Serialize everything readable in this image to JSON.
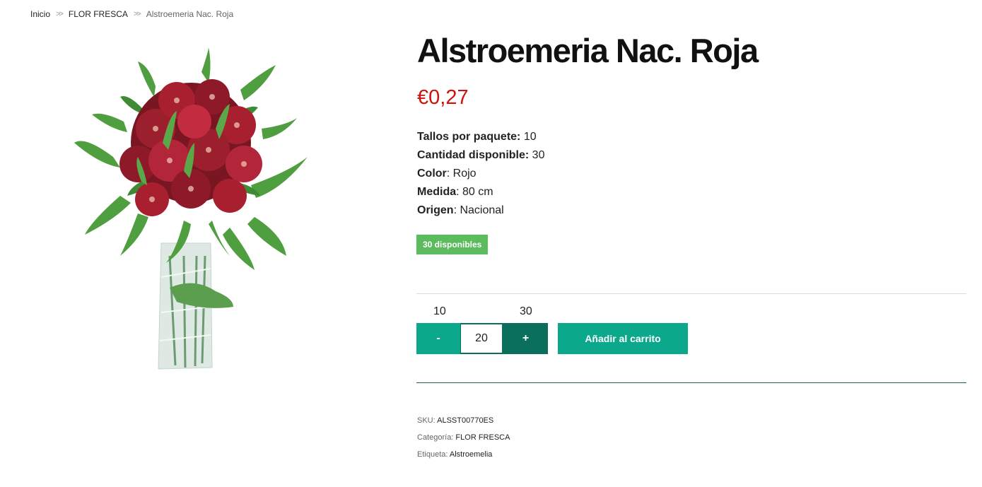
{
  "breadcrumb": {
    "home": "Inicio",
    "category": "FLOR FRESCA",
    "current": "Alstroemeria Nac. Roja",
    "separator": ">>"
  },
  "product": {
    "title": "Alstroemeria Nac. Roja",
    "price": "€0,27",
    "image_icon": "flower-bouquet-image",
    "attributes": [
      {
        "label": "Tallos por paquete:",
        "value": " 10"
      },
      {
        "label": "Cantidad disponible:",
        "value": " 30"
      },
      {
        "label": "Color",
        "value": ": Rojo"
      },
      {
        "label": "Medida",
        "value": ": 80 cm"
      },
      {
        "label": "Origen",
        "value": ": Nacional"
      }
    ],
    "stock_badge": "30 disponibles"
  },
  "quantity": {
    "min": "10",
    "max": "30",
    "value": "20",
    "minus_label": "-",
    "plus_label": "+"
  },
  "cart": {
    "add_label": "Añadir al carrito"
  },
  "meta": {
    "sku_label": "SKU: ",
    "sku": "ALSST00770ES",
    "category_label": "Categoría: ",
    "category": "FLOR FRESCA",
    "tag_label": "Etiqueta: ",
    "tag": "Alstroemelia"
  },
  "colors": {
    "accent": "#0ca88c",
    "accent_dark": "#0a6f5d",
    "price": "#d0110e",
    "stock": "#5cbb5c"
  }
}
